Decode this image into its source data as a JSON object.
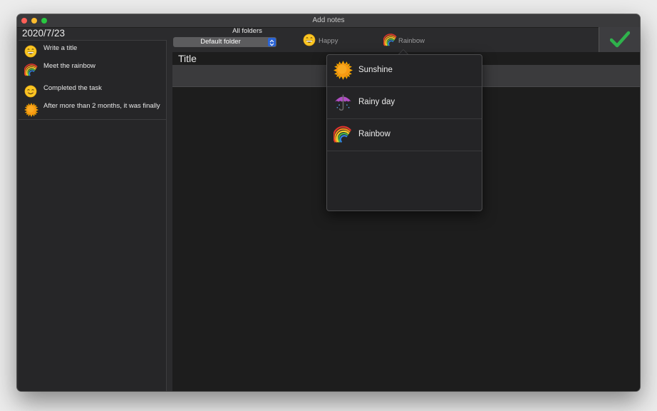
{
  "window": {
    "title": "Add notes"
  },
  "date": "2020/7/23",
  "sidebar": {
    "notes": [
      {
        "label": "Write a title",
        "icon": "grinning-face-icon"
      },
      {
        "label": "Meet the rainbow",
        "icon": "rainbow-icon"
      },
      {
        "label": "Completed the task",
        "icon": "smiling-face-icon"
      },
      {
        "label": "After more than 2 months, it was finally",
        "icon": "sun-icon"
      }
    ]
  },
  "toolbar": {
    "folder_label": "All folders",
    "folder_value": "Default folder",
    "mood_label": "Happy",
    "weather_label": "Rainbow",
    "accent_color": "#2a64d6",
    "check_color": "#2fb24c"
  },
  "editor": {
    "title_label": "Title"
  },
  "weather_menu": {
    "items": [
      {
        "label": "Sunshine",
        "icon": "sun-icon"
      },
      {
        "label": "Rainy day",
        "icon": "umbrella-icon"
      },
      {
        "label": "Rainbow",
        "icon": "rainbow-icon"
      }
    ]
  }
}
